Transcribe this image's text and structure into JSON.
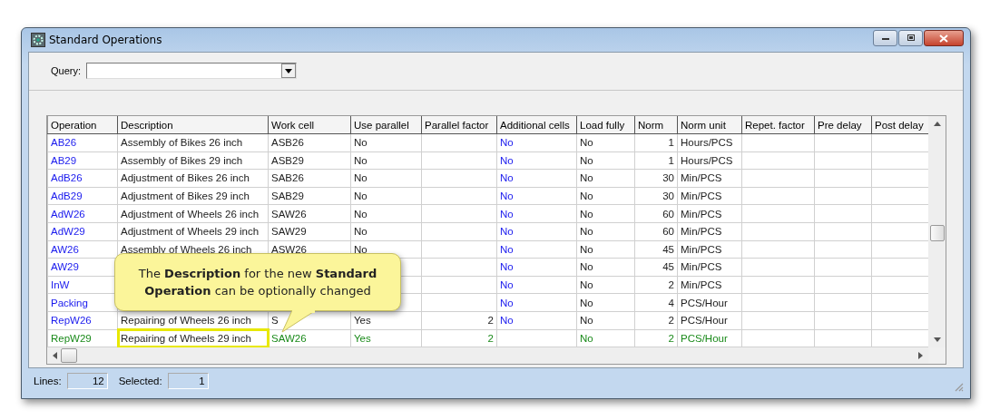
{
  "window": {
    "title": "Standard Operations"
  },
  "query": {
    "label": "Query:"
  },
  "table": {
    "columns": [
      {
        "label": "Operation",
        "kind": "link"
      },
      {
        "label": "Description",
        "kind": "text"
      },
      {
        "label": "Work cell",
        "kind": "text"
      },
      {
        "label": "Use parallel",
        "kind": "text"
      },
      {
        "label": "Parallel factor",
        "kind": "number"
      },
      {
        "label": "Additional cells",
        "kind": "link"
      },
      {
        "label": "Load fully",
        "kind": "text"
      },
      {
        "label": "Norm",
        "kind": "number"
      },
      {
        "label": "Norm unit",
        "kind": "text"
      },
      {
        "label": "Repet. factor",
        "kind": "text"
      },
      {
        "label": "Pre delay",
        "kind": "text"
      },
      {
        "label": "Post delay",
        "kind": "text"
      }
    ],
    "rows": [
      {
        "selected": false,
        "cells": [
          "AB26",
          "Assembly of Bikes 26 inch",
          "ASB26",
          "No",
          null,
          "No",
          "No",
          "1",
          "Hours/PCS",
          null,
          null,
          null
        ]
      },
      {
        "selected": false,
        "cells": [
          "AB29",
          "Assembly of Bikes 29 inch",
          "ASB29",
          "No",
          null,
          "No",
          "No",
          "1",
          "Hours/PCS",
          null,
          null,
          null
        ]
      },
      {
        "selected": false,
        "cells": [
          "AdB26",
          "Adjustment of Bikes 26 inch",
          "SAB26",
          "No",
          null,
          "No",
          "No",
          "30",
          "Min/PCS",
          null,
          null,
          null
        ]
      },
      {
        "selected": false,
        "cells": [
          "AdB29",
          "Adjustment of Bikes 29 inch",
          "SAB29",
          "No",
          null,
          "No",
          "No",
          "30",
          "Min/PCS",
          null,
          null,
          null
        ]
      },
      {
        "selected": false,
        "cells": [
          "AdW26",
          "Adjustment of Wheels 26 inch",
          "SAW26",
          "No",
          null,
          "No",
          "No",
          "60",
          "Min/PCS",
          null,
          null,
          null
        ]
      },
      {
        "selected": false,
        "cells": [
          "AdW29",
          "Adjustment of Wheels 29 inch",
          "SAW29",
          "No",
          null,
          "No",
          "No",
          "60",
          "Min/PCS",
          null,
          null,
          null
        ]
      },
      {
        "selected": false,
        "cells": [
          "AW26",
          "Assembly of Wheels 26 inch",
          "ASW26",
          "No",
          null,
          "No",
          "No",
          "45",
          "Min/PCS",
          null,
          null,
          null
        ]
      },
      {
        "selected": false,
        "cells": [
          "AW29",
          null,
          null,
          null,
          null,
          "No",
          "No",
          "45",
          "Min/PCS",
          null,
          null,
          null
        ]
      },
      {
        "selected": false,
        "cells": [
          "InW",
          null,
          null,
          null,
          null,
          "No",
          "No",
          "2",
          "Min/PCS",
          null,
          null,
          null
        ]
      },
      {
        "selected": false,
        "cells": [
          "Packing",
          null,
          null,
          null,
          null,
          "No",
          "No",
          "4",
          "PCS/Hour",
          null,
          null,
          null
        ]
      },
      {
        "selected": false,
        "cells": [
          "RepW26",
          "Repairing of Wheels 26 inch",
          "S",
          "Yes",
          "2",
          "No",
          "No",
          "2",
          "PCS/Hour",
          null,
          null,
          null
        ]
      },
      {
        "selected": true,
        "cells": [
          "RepW29",
          "Repairing of Wheels 29 inch",
          "SAW26",
          "Yes",
          "2",
          null,
          "No",
          "2",
          "PCS/Hour",
          null,
          null,
          null
        ]
      }
    ]
  },
  "callout": {
    "text": "The **Description** for the new **Standard Operation** can be optionally changed"
  },
  "status_bar": {
    "lines_label": "Lines:",
    "lines": "12",
    "selected_label": "Selected:",
    "selected": "1"
  }
}
